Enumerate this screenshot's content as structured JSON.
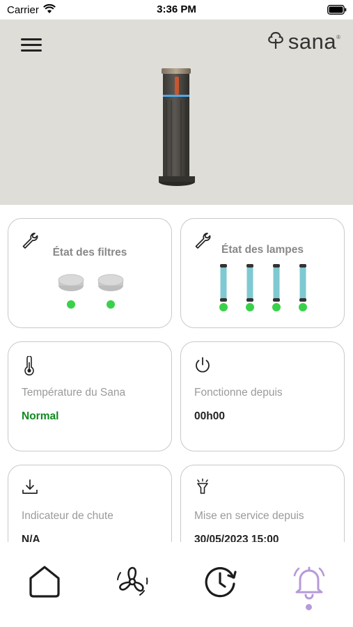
{
  "status_bar": {
    "carrier": "Carrier",
    "time": "3:36 PM"
  },
  "brand": {
    "name": "sana",
    "reg_mark": "®"
  },
  "colors": {
    "ok_green": "#0e8a1e",
    "dot_green": "#3ad14a",
    "lamp_teal": "#7fc9d2",
    "active_nav": "#b79ad9",
    "hero_bg": "#dfddd8"
  },
  "cards": {
    "filters": {
      "title": "État des filtres",
      "icon": "wrench-icon",
      "filter_count": 2
    },
    "lamps": {
      "title": "État des lampes",
      "icon": "wrench-icon",
      "lamp_count": 4
    },
    "temperature": {
      "label": "Température du Sana",
      "value": "Normal",
      "icon": "thermometer-icon"
    },
    "runtime": {
      "label": "Fonctionne depuis",
      "value": "00h00",
      "icon": "power-icon"
    },
    "drop": {
      "label": "Indicateur de chute",
      "value": "N/A",
      "icon": "download-icon"
    },
    "service": {
      "label": "Mise en service depuis",
      "value": "30/05/2023 15:00",
      "icon": "lamp-icon"
    }
  },
  "nav": {
    "items": [
      {
        "name": "home",
        "icon": "home-icon"
      },
      {
        "name": "fan",
        "icon": "fan-icon"
      },
      {
        "name": "history",
        "icon": "history-clock-icon"
      },
      {
        "name": "alerts",
        "icon": "bell-icon",
        "active": true
      }
    ]
  }
}
